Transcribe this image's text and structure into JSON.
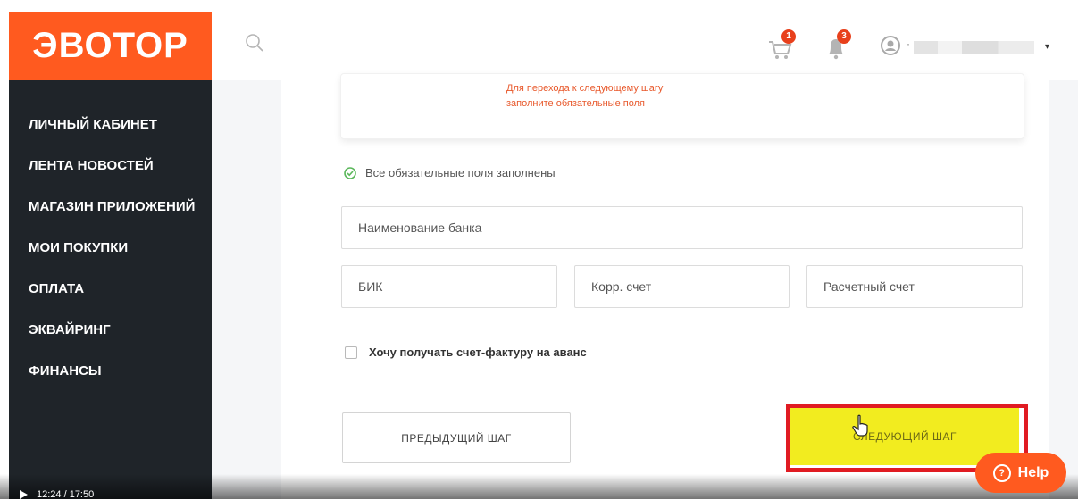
{
  "logo": {
    "text": "ЭВОТОР"
  },
  "colors": {
    "brand": "#ff5a1f",
    "sidebar": "#1f2429",
    "accent_yellow": "#f2ec1f",
    "badge": "#e8401c",
    "highlight": "#e01b22",
    "success": "#5cb85c"
  },
  "sidebar": {
    "items": [
      {
        "label": "ЛИЧНЫЙ КАБИНЕТ"
      },
      {
        "label": "ЛЕНТА НОВОСТЕЙ"
      },
      {
        "label": "МАГАЗИН ПРИЛОЖЕНИЙ"
      },
      {
        "label": "МОИ ПОКУПКИ"
      },
      {
        "label": "ОПЛАТА"
      },
      {
        "label": "ЭКВАЙРИНГ"
      },
      {
        "label": "ФИНАНСЫ"
      }
    ]
  },
  "header": {
    "search_icon": "search-icon",
    "cart": {
      "icon": "cart-icon",
      "count": "1"
    },
    "notifications": {
      "icon": "bell-icon",
      "count": "3"
    },
    "user": {
      "icon": "user-icon",
      "name": "·"
    }
  },
  "form": {
    "warning": "Для перехода к следующему шагу заполните обязательные поля",
    "status": "Все обязательные поля заполнены",
    "bank_name_placeholder": "Наименование банка",
    "bik_placeholder": "БИК",
    "corr_placeholder": "Корр. счет",
    "account_placeholder": "Расчетный счет",
    "invoice_checkbox": "Хочу получать счет-фактуру на аванс",
    "prev_button": "ПРЕДЫДУЩИЙ ШАГ",
    "next_button": "СЛЕДУЮЩИЙ ШАГ"
  },
  "help": {
    "label": "Help"
  },
  "video": {
    "time": "12:24 / 17:50"
  }
}
